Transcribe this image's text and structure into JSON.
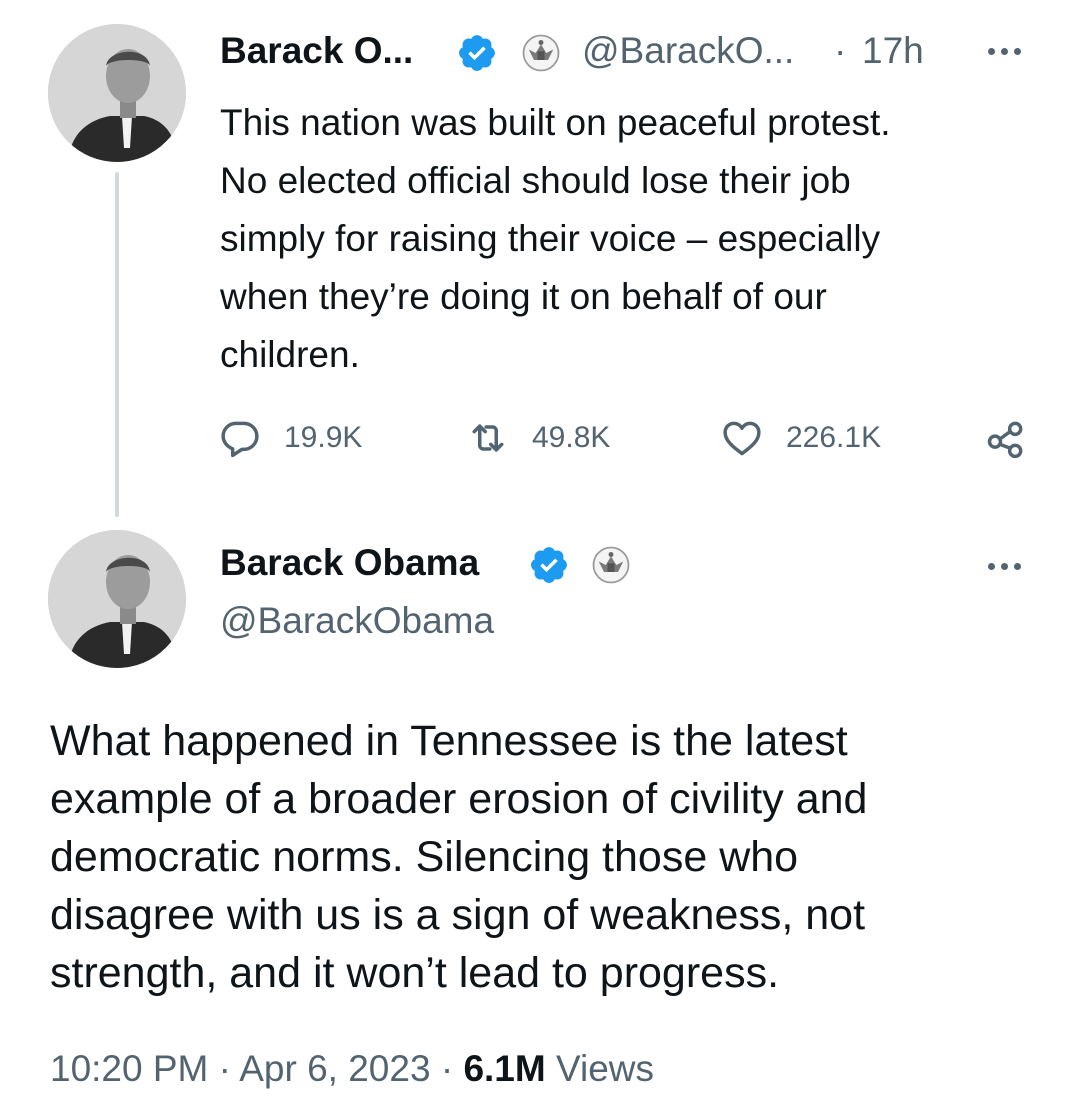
{
  "tweet_parent": {
    "author_name": "Barack O...",
    "handle": "@BarackO...",
    "separator": "·",
    "time": "17h",
    "text_lines": [
      "This nation was built on peaceful protest.",
      "No elected official should lose their job",
      "simply for raising their voice – especially",
      "when they’re doing it on behalf of our",
      "children."
    ],
    "replies": "19.9K",
    "retweets": "49.8K",
    "likes": "226.1K"
  },
  "tweet_main": {
    "author_name": "Barack Obama",
    "handle": "@BarackObama",
    "text_lines": [
      "What happened in Tennessee is the latest",
      "example of a broader erosion of civility and",
      "democratic norms. Silencing those who",
      "disagree with us is a sign of weakness, not",
      "strength, and it won’t lead to progress."
    ],
    "time": "10:20 PM",
    "separator": "·",
    "date": "Apr 6, 2023",
    "views_count": "6.1M",
    "views_label": "Views"
  },
  "icons": {
    "verified": "verified-badge-icon",
    "seal": "government-seal-icon",
    "reply": "reply-icon",
    "retweet": "retweet-icon",
    "like": "heart-icon",
    "share": "share-icon",
    "more": "more-icon"
  },
  "colors": {
    "verified_blue": "#1d9bf0",
    "text_primary": "#0f1419",
    "text_secondary": "#536471",
    "thread_line": "#cfd9de"
  }
}
